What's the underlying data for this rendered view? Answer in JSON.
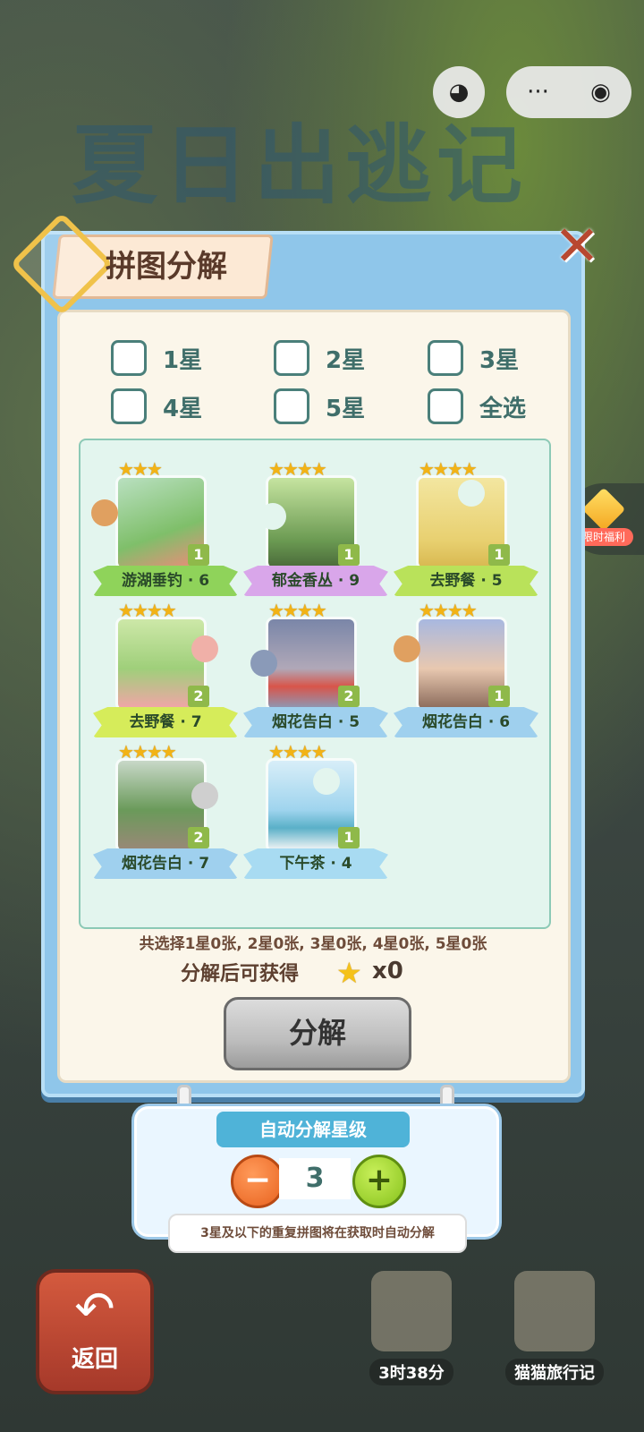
{
  "background": {
    "game_title": "夏日出逃记"
  },
  "top_bar": {
    "left_icon": "pacman-icon",
    "more_icon": "more-dots-icon",
    "target_icon": "target-icon",
    "more_glyph": "···",
    "target_glyph": "◉",
    "left_glyph": "◕"
  },
  "side_badge": {
    "label": "限时福利"
  },
  "dialog": {
    "title": "拼图分解",
    "close_glyph": "✕",
    "filters": [
      {
        "label": "1星"
      },
      {
        "label": "2星"
      },
      {
        "label": "3星"
      },
      {
        "label": "4星"
      },
      {
        "label": "5星"
      },
      {
        "label": "全选"
      }
    ],
    "cards": [
      {
        "name": "游湖垂钓 · 6",
        "count": "1",
        "stars": "★★★",
        "color": "#8fd35a"
      },
      {
        "name": "郁金香丛 · 9",
        "count": "1",
        "stars": "★★★★",
        "color": "#d9a6ea"
      },
      {
        "name": "去野餐 · 5",
        "count": "1",
        "stars": "★★★★",
        "color": "#b9e25a"
      },
      {
        "name": "去野餐 · 7",
        "count": "2",
        "stars": "★★★★",
        "color": "#d6ec5a"
      },
      {
        "name": "烟花告白 · 5",
        "count": "2",
        "stars": "★★★★",
        "color": "#9fd0ee"
      },
      {
        "name": "烟花告白 · 6",
        "count": "1",
        "stars": "★★★★",
        "color": "#9fd0ee"
      },
      {
        "name": "烟花告白 · 7",
        "count": "2",
        "stars": "★★★★",
        "color": "#9fd0ee"
      },
      {
        "name": "下午茶 · 4",
        "count": "1",
        "stars": "★★★★",
        "color": "#a8dbf2"
      }
    ],
    "summary": "共选择1星0张, 2星0张, 3星0张, 4星0张, 5星0张",
    "gain_label": "分解后可获得",
    "gain_star": "★",
    "gain_value": "x0",
    "decompose_label": "分解"
  },
  "auto_decompose": {
    "title": "自动分解星级",
    "minus": "−",
    "plus": "+",
    "level": "3",
    "tip": "3星及以下的重复拼图将在获取时自动分解"
  },
  "bottom": {
    "back_label": "返回",
    "back_glyph": "↶",
    "timer": "3时38分",
    "travel_label": "猫猫旅行记"
  }
}
